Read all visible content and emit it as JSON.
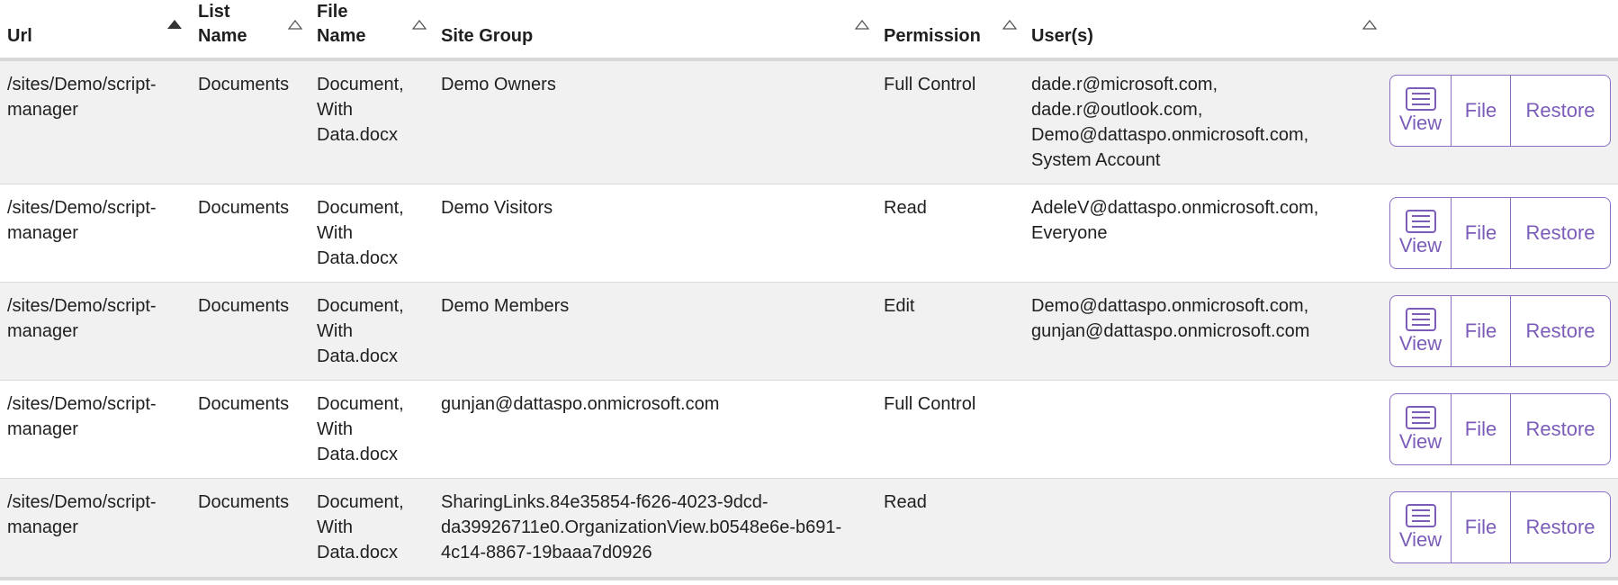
{
  "columns": [
    {
      "key": "url",
      "label": "Url",
      "sort": "asc"
    },
    {
      "key": "list_name",
      "label": "List Name",
      "sort": "none"
    },
    {
      "key": "file_name",
      "label": "File Name",
      "sort": "none"
    },
    {
      "key": "site_group",
      "label": "Site Group",
      "sort": "none"
    },
    {
      "key": "permission",
      "label": "Permission",
      "sort": "none"
    },
    {
      "key": "users",
      "label": "User(s)",
      "sort": "none"
    }
  ],
  "header_labels": {
    "url": "Url",
    "list_name_1": "List",
    "list_name_2": "Name",
    "file_name_1": "File",
    "file_name_2": "Name",
    "site_group": "Site Group",
    "permission": "Permission",
    "users": "User(s)"
  },
  "actions": {
    "view_label": "View",
    "file_label": "File",
    "restore_label": "Restore"
  },
  "accent_color": "#7b5cb8",
  "rows": [
    {
      "url_1": "/sites/Demo/script-",
      "url_2": "manager",
      "list_name": "Documents",
      "file_1": "Document,",
      "file_2": "With",
      "file_3": "Data.docx",
      "site_group_1": "Demo Owners",
      "site_group_2": "",
      "site_group_3": "",
      "permission": "Full Control",
      "users_1": "dade.r@microsoft.com,",
      "users_2": "dade.r@outlook.com,",
      "users_3": "Demo@dattaspo.onmicrosoft.com,",
      "users_4": "System Account"
    },
    {
      "url_1": "/sites/Demo/script-",
      "url_2": "manager",
      "list_name": "Documents",
      "file_1": "Document,",
      "file_2": "With",
      "file_3": "Data.docx",
      "site_group_1": "Demo Visitors",
      "site_group_2": "",
      "site_group_3": "",
      "permission": "Read",
      "users_1": "AdeleV@dattaspo.onmicrosoft.com,",
      "users_2": "Everyone",
      "users_3": "",
      "users_4": ""
    },
    {
      "url_1": "/sites/Demo/script-",
      "url_2": "manager",
      "list_name": "Documents",
      "file_1": "Document,",
      "file_2": "With",
      "file_3": "Data.docx",
      "site_group_1": "Demo Members",
      "site_group_2": "",
      "site_group_3": "",
      "permission": "Edit",
      "users_1": "Demo@dattaspo.onmicrosoft.com,",
      "users_2": "gunjan@dattaspo.onmicrosoft.com",
      "users_3": "",
      "users_4": ""
    },
    {
      "url_1": "/sites/Demo/script-",
      "url_2": "manager",
      "list_name": "Documents",
      "file_1": "Document,",
      "file_2": "With",
      "file_3": "Data.docx",
      "site_group_1": "gunjan@dattaspo.onmicrosoft.com",
      "site_group_2": "",
      "site_group_3": "",
      "permission": "Full Control",
      "users_1": "",
      "users_2": "",
      "users_3": "",
      "users_4": ""
    },
    {
      "url_1": "/sites/Demo/script-",
      "url_2": "manager",
      "list_name": "Documents",
      "file_1": "Document,",
      "file_2": "With",
      "file_3": "Data.docx",
      "site_group_1": "SharingLinks.84e35854-f626-4023-9dcd-",
      "site_group_2": "da39926711e0.OrganizationView.b0548e6e-b691-",
      "site_group_3": "4c14-8867-19baaa7d0926",
      "permission": "Read",
      "users_1": "",
      "users_2": "",
      "users_3": "",
      "users_4": ""
    }
  ]
}
